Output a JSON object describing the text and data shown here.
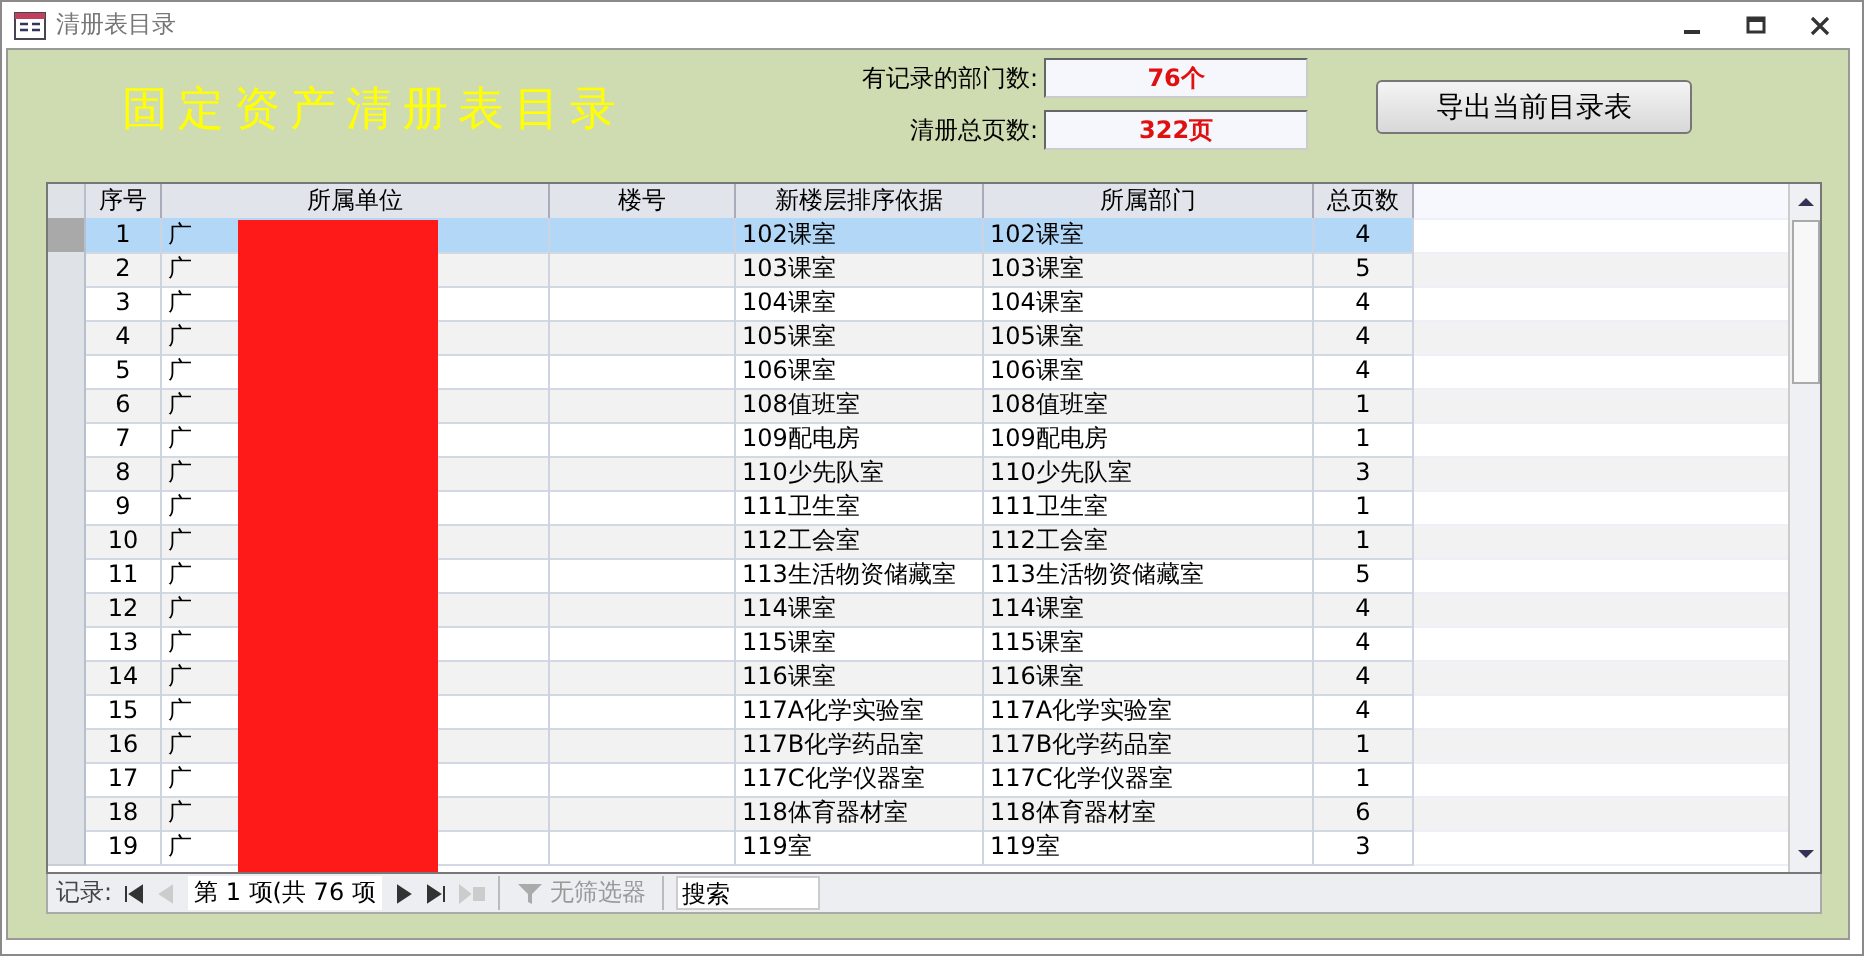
{
  "window": {
    "title": "清册表目录"
  },
  "heading": "固定资产清册表目录",
  "summary": [
    {
      "label": "有记录的部门数:",
      "value": "76个"
    },
    {
      "label": "清册总页数:",
      "value": "322页"
    }
  ],
  "export_button": "导出当前目录表",
  "table": {
    "columns": [
      "序号",
      "所属单位",
      "楼号",
      "新楼层排序依据",
      "所属部门",
      "总页数"
    ],
    "rows": [
      {
        "no": "1",
        "unit": "广",
        "sort_basis": "102课室",
        "department": "102课室",
        "pages": "4",
        "selected": true
      },
      {
        "no": "2",
        "unit": "广",
        "sort_basis": "103课室",
        "department": "103课室",
        "pages": "5",
        "selected": false
      },
      {
        "no": "3",
        "unit": "广",
        "sort_basis": "104课室",
        "department": "104课室",
        "pages": "4",
        "selected": false
      },
      {
        "no": "4",
        "unit": "广",
        "sort_basis": "105课室",
        "department": "105课室",
        "pages": "4",
        "selected": false
      },
      {
        "no": "5",
        "unit": "广",
        "sort_basis": "106课室",
        "department": "106课室",
        "pages": "4",
        "selected": false
      },
      {
        "no": "6",
        "unit": "广",
        "sort_basis": "108值班室",
        "department": "108值班室",
        "pages": "1",
        "selected": false
      },
      {
        "no": "7",
        "unit": "广",
        "sort_basis": "109配电房",
        "department": "109配电房",
        "pages": "1",
        "selected": false
      },
      {
        "no": "8",
        "unit": "广",
        "sort_basis": "110少先队室",
        "department": "110少先队室",
        "pages": "3",
        "selected": false
      },
      {
        "no": "9",
        "unit": "广",
        "sort_basis": "111卫生室",
        "department": "111卫生室",
        "pages": "1",
        "selected": false
      },
      {
        "no": "10",
        "unit": "广",
        "sort_basis": "112工会室",
        "department": "112工会室",
        "pages": "1",
        "selected": false
      },
      {
        "no": "11",
        "unit": "广",
        "sort_basis": "113生活物资储藏室",
        "department": "113生活物资储藏室",
        "pages": "5",
        "selected": false
      },
      {
        "no": "12",
        "unit": "广",
        "sort_basis": "114课室",
        "department": "114课室",
        "pages": "4",
        "selected": false
      },
      {
        "no": "13",
        "unit": "广",
        "sort_basis": "115课室",
        "department": "115课室",
        "pages": "4",
        "selected": false
      },
      {
        "no": "14",
        "unit": "广",
        "sort_basis": "116课室",
        "department": "116课室",
        "pages": "4",
        "selected": false
      },
      {
        "no": "15",
        "unit": "广",
        "sort_basis": "117A化学实验室",
        "department": "117A化学实验室",
        "pages": "4",
        "selected": false
      },
      {
        "no": "16",
        "unit": "广",
        "sort_basis": "117B化学药品室",
        "department": "117B化学药品室",
        "pages": "1",
        "selected": false
      },
      {
        "no": "17",
        "unit": "广",
        "sort_basis": "117C化学仪器室",
        "department": "117C化学仪器室",
        "pages": "1",
        "selected": false
      },
      {
        "no": "18",
        "unit": "广",
        "sort_basis": "118体育器材室",
        "department": "118体育器材室",
        "pages": "6",
        "selected": false
      },
      {
        "no": "19",
        "unit": "广",
        "sort_basis": "119室",
        "department": "119室",
        "pages": "3",
        "selected": false
      }
    ]
  },
  "navigator": {
    "label": "记录:",
    "position": "第 1 项(共 76 项",
    "filter": "无筛选器",
    "search_placeholder": "搜索",
    "buttons": [
      {
        "kind": "first",
        "disabled": false
      },
      {
        "kind": "prev",
        "disabled": true
      },
      {
        "kind": "next",
        "disabled": false
      },
      {
        "kind": "last",
        "disabled": false
      },
      {
        "kind": "new",
        "disabled": true
      }
    ]
  }
}
